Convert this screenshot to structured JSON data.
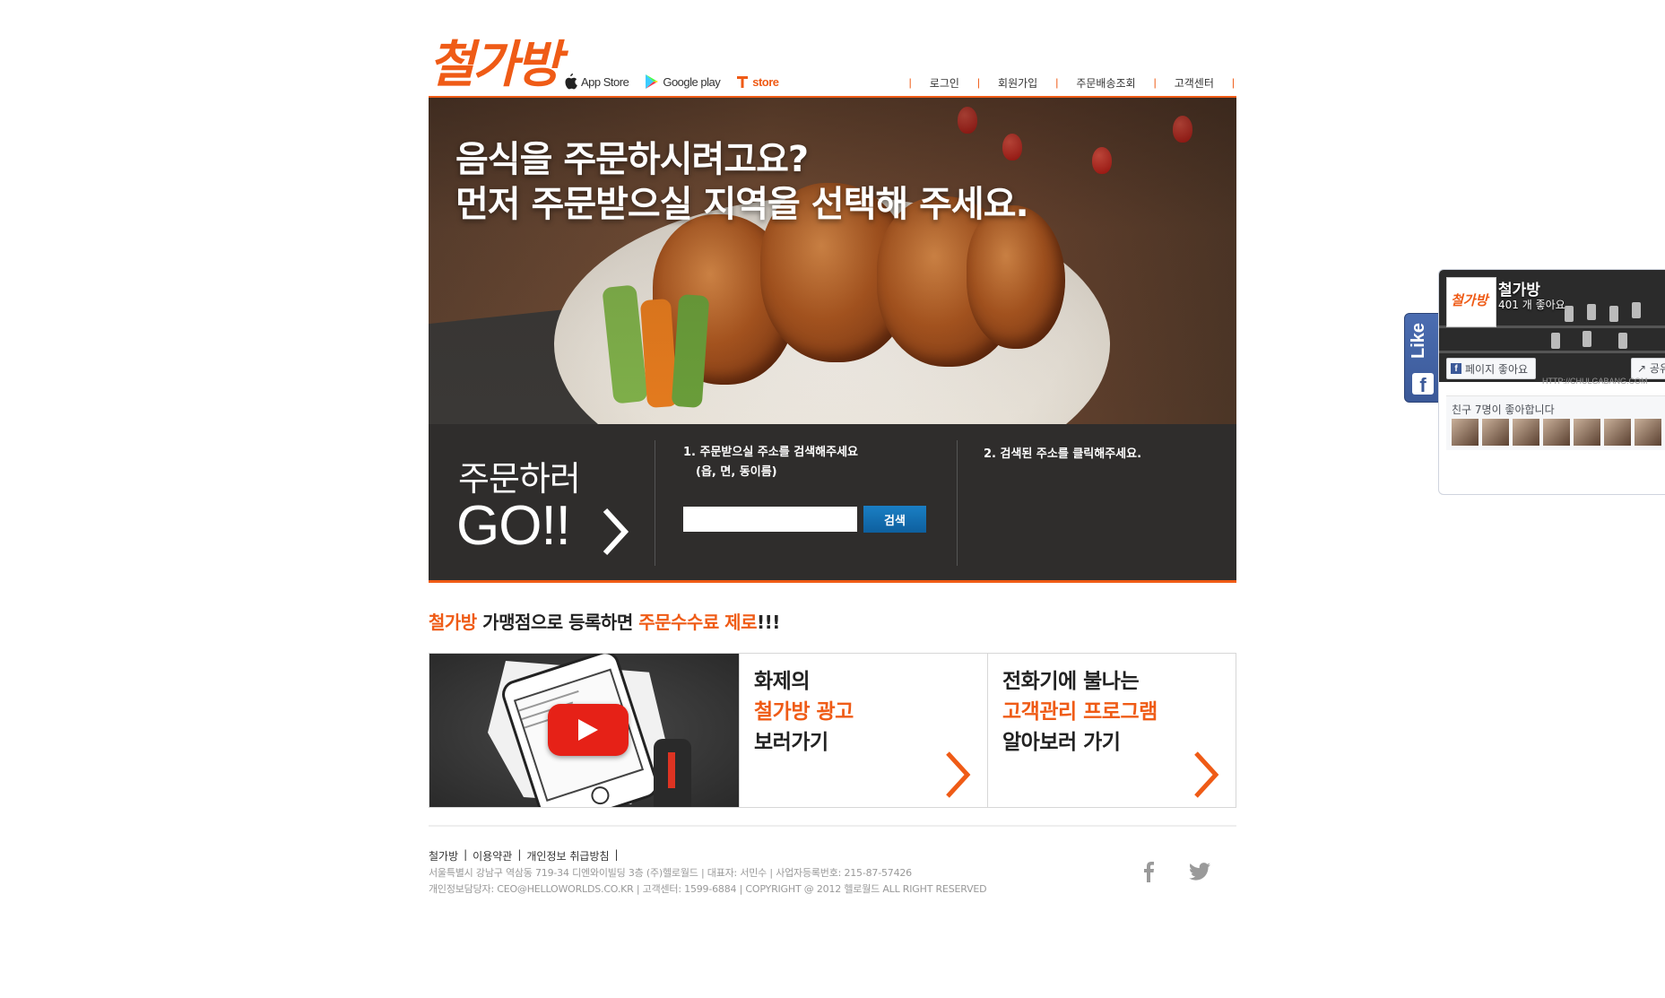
{
  "brand": {
    "logo_text": "철가방",
    "accent_color": "#ef5b16"
  },
  "stores": [
    {
      "label": "App Store",
      "icon": "apple-icon"
    },
    {
      "label": "Google play",
      "icon": "google-play-icon"
    },
    {
      "label": "store",
      "icon": "tstore-icon"
    }
  ],
  "nav": {
    "login": "로그인",
    "signup": "회원가입",
    "order_lookup": "주문배송조회",
    "support": "고객센터"
  },
  "hero": {
    "line1": "음식을 주문하시려고요?",
    "line2": "먼저 주문받으실 지역을 선택해 주세요."
  },
  "order": {
    "go_label": "주문하러",
    "go_text": "GO!!",
    "step1": "1. 주문받으실 주소를 검색해주세요",
    "step1_sub": "(읍, 면, 동이름)",
    "step2": "2. 검색된 주소를 클릭해주세요.",
    "search_value": "",
    "search_button": "검색"
  },
  "promo": {
    "brand": "철가방",
    "middle": "가맹점으로 등록하면",
    "highlight": "주문수수료 제로",
    "suffix": "!!!"
  },
  "cards": {
    "ad": {
      "line1": "화제의",
      "line2": "철가방 광고",
      "line3": "보러가기"
    },
    "crm": {
      "line1": "전화기에 불나는",
      "line2": "고객관리 프로그램",
      "line3": "알아보러 가기"
    }
  },
  "footer": {
    "links": [
      "철가방",
      "이용약관",
      "개인정보 취급방침"
    ],
    "address": "서울특별시 강남구 역삼동 719-34 디엔와이빌딩 3층 (주)헬로월드 | 대표자: 서민수 | 사업자등록번호: 215-87-57426",
    "contact": "개인정보담당자: CEO@HELLOWORLDS.CO.KR | 고객센터: 1599-6884 | COPYRIGHT @ 2012 헬로월드 ALL RIGHT RESERVED"
  },
  "facebook": {
    "tab_label": "Like",
    "page_name": "철가방",
    "like_count": "401 개 좋아요",
    "like_button": "페이지 좋아요",
    "share_button": "공유",
    "cover_url": "HTTP://CHULGABANG.COM",
    "friends_text": "친구 7명이 좋아합니다",
    "thumb_text": "철가방",
    "cover_brand_fragment": "BANG"
  }
}
